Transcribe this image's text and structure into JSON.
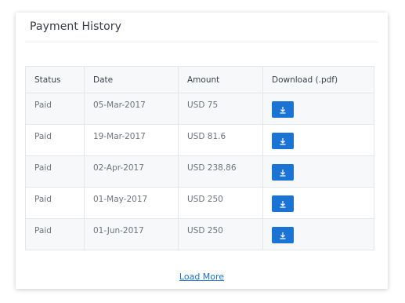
{
  "card": {
    "title": "Payment History"
  },
  "table": {
    "headers": {
      "status": "Status",
      "date": "Date",
      "amount": "Amount",
      "download": "Download (.pdf)"
    },
    "rows": [
      {
        "status": "Paid",
        "date": "05-Mar-2017",
        "amount": "USD 75",
        "download_icon": "download-icon"
      },
      {
        "status": "Paid",
        "date": "19-Mar-2017",
        "amount": "USD 81.6",
        "download_icon": "download-icon"
      },
      {
        "status": "Paid",
        "date": "02-Apr-2017",
        "amount": "USD 238.86",
        "download_icon": "download-icon"
      },
      {
        "status": "Paid",
        "date": "01-May-2017",
        "amount": "USD 250",
        "download_icon": "download-icon"
      },
      {
        "status": "Paid",
        "date": "01-Jun-2017",
        "amount": "USD 250",
        "download_icon": "download-icon"
      }
    ]
  },
  "footer": {
    "load_more_label": "Load More"
  },
  "colors": {
    "accent": "#1b73d4",
    "link": "#1d6fc8",
    "header_bg": "#f7f8fa"
  }
}
